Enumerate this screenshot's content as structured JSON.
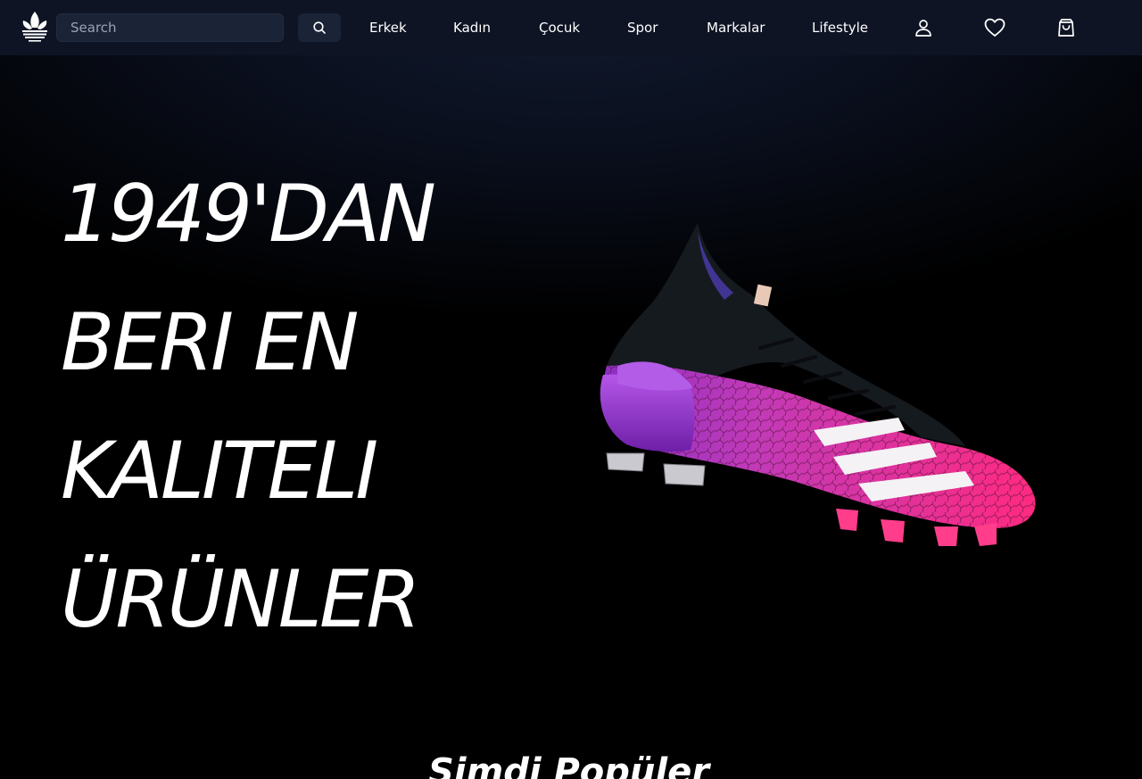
{
  "header": {
    "search": {
      "placeholder": "Search"
    },
    "nav": [
      {
        "label": "Erkek"
      },
      {
        "label": "Kadın"
      },
      {
        "label": "Çocuk"
      },
      {
        "label": "Spor"
      },
      {
        "label": "Markalar"
      },
      {
        "label": "Lifestyle"
      }
    ],
    "icons": [
      "search-icon",
      "user-icon",
      "heart-icon",
      "shopping-bag-icon"
    ]
  },
  "hero": {
    "title_lines": [
      "1949'DAN",
      "BERI EN",
      "KALITELI",
      "ÜRÜNLER"
    ]
  },
  "popular": {
    "title": "Şimdi Popüler"
  },
  "colors": {
    "nav_background": "#0e1424",
    "search_background": "#1b2336",
    "shoe_pink": "#ff2a7a",
    "shoe_purple": "#a23dd6",
    "shoe_black": "#16191e"
  }
}
